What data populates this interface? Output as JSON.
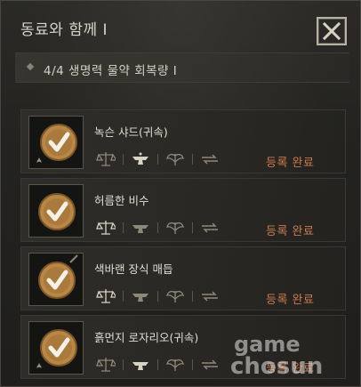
{
  "window": {
    "title": "동료와 함께 Ⅰ",
    "close_icon": "close-x-icon"
  },
  "quest": {
    "progress_text": "4/4  생명력 물약 회복량 Ⅰ"
  },
  "companions": [
    {
      "name": "녹슨 샤드(귀속)",
      "status": "등록 완료",
      "icon": "checkmark-badge-icon"
    },
    {
      "name": "허름한 비수",
      "status": "등록 완료",
      "icon": "checkmark-badge-icon"
    },
    {
      "name": "색바랜 장식 매듭",
      "status": "등록 완료",
      "icon": "checkmark-badge-icon"
    },
    {
      "name": "흙먼지 로자리오(귀속)",
      "status": "등록 완료",
      "icon": "checkmark-badge-icon"
    }
  ],
  "slot_icons": [
    "scale-icon",
    "anvil-icon",
    "wings-icon",
    "arrows-icon"
  ],
  "colors": {
    "status": "#c97a4a",
    "badge": "#b88746"
  },
  "watermark": {
    "line1": "game",
    "line2": "chosun"
  }
}
